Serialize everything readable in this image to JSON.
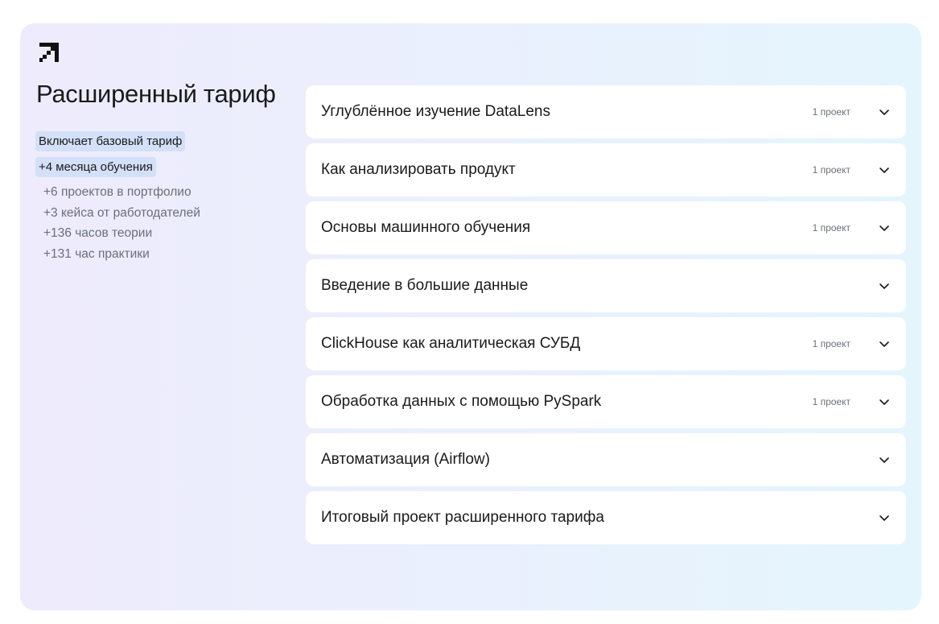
{
  "tariff": {
    "title": "Расширенный тариф",
    "chips": [
      "Включает базовый тариф",
      "+4 месяца обучения"
    ],
    "features": [
      "+6 проектов в портфолио",
      "+3 кейса от работодателей",
      "+136 часов теории",
      "+131 час практики"
    ]
  },
  "modules": [
    {
      "title": "Углублённое изучение DataLens",
      "badge": "1 проект"
    },
    {
      "title": "Как анализировать продукт",
      "badge": "1 проект"
    },
    {
      "title": "Основы машинного обучения",
      "badge": "1 проект"
    },
    {
      "title": "Введение в большие данные",
      "badge": ""
    },
    {
      "title": "ClickHouse как аналитическая СУБД",
      "badge": "1 проект"
    },
    {
      "title": "Обработка данных с помощью PySpark",
      "badge": "1 проект"
    },
    {
      "title": "Автоматизация (Airflow)",
      "badge": ""
    },
    {
      "title": "Итоговый проект расширенного тарифа",
      "badge": ""
    }
  ],
  "icons": {
    "logo": "arrow-up-left-pixel-icon",
    "expand": "chevron-down-icon"
  },
  "colors": {
    "chip_bg": "#d3e0f8",
    "muted_text": "#6b6f78",
    "card_gradient_start": "#eeebfc",
    "card_gradient_end": "#e4f5fd"
  }
}
